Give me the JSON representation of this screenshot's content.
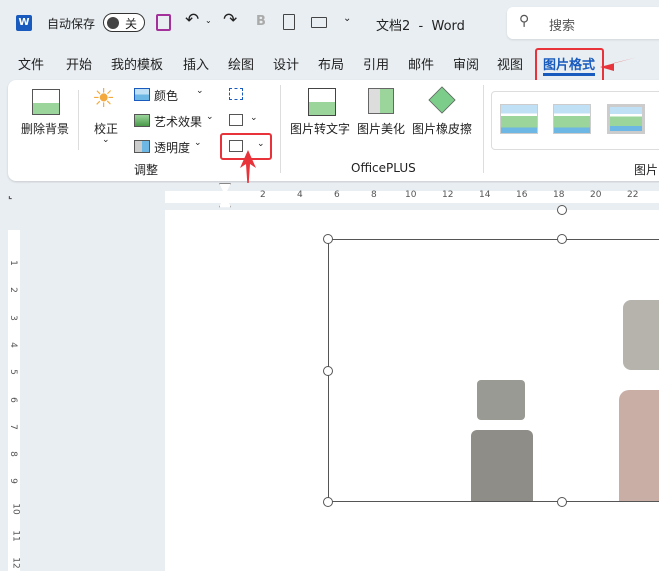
{
  "titlebar": {
    "autosave_label": "自动保存",
    "autosave_state": "关",
    "doc_title": "文档2  -  Word",
    "search_placeholder": "搜索",
    "bold_glyph": "B"
  },
  "tabs": [
    "文件",
    "开始",
    "我的模板",
    "插入",
    "绘图",
    "设计",
    "布局",
    "引用",
    "邮件",
    "审阅",
    "视图",
    "图片格式"
  ],
  "active_tab": "图片格式",
  "ribbon": {
    "remove_bg": "删除背景",
    "correct": "校正",
    "color": "颜色",
    "art_effects": "艺术效果",
    "transparency": "透明度",
    "group_adjust": "调整",
    "pic_to_text": "图片转文字",
    "pic_beautify": "图片美化",
    "pic_eraser": "图片橡皮擦",
    "group_officeplus": "OfficePLUS",
    "group_styles_partial": "图片"
  },
  "ruler_h": [
    "2",
    "4",
    "6",
    "8",
    "10",
    "12",
    "14",
    "16",
    "18",
    "20",
    "22"
  ],
  "ruler_v": [
    "1",
    "2",
    "3",
    "4",
    "5",
    "6",
    "7",
    "8",
    "9",
    "10",
    "11",
    "12"
  ],
  "colors": {
    "accent": "#185abd",
    "annotation": "#e8333a",
    "word_icon": "#185abd"
  }
}
